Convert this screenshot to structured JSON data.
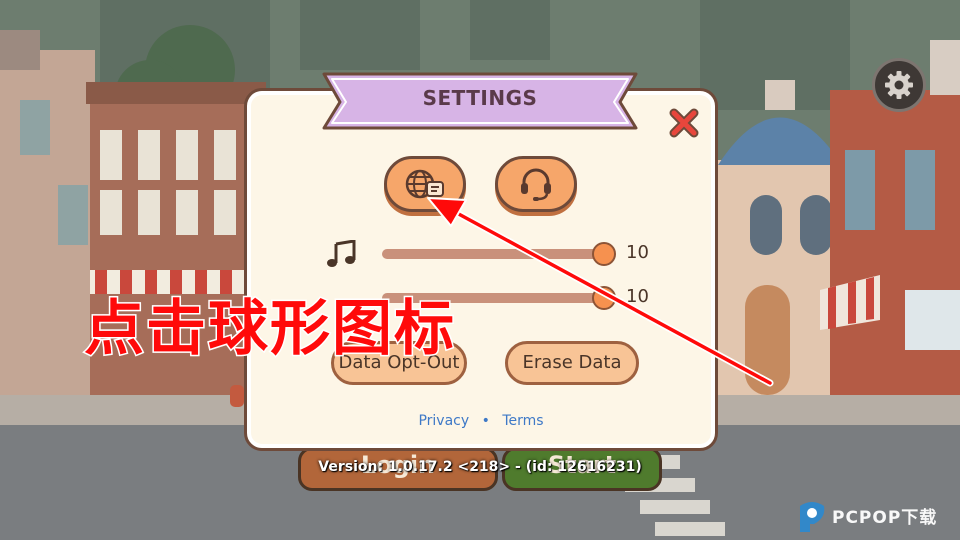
{
  "settings": {
    "title": "SETTINGS",
    "buttons": {
      "language": "globe-icon",
      "support": "headset-icon",
      "close": "close-icon"
    },
    "sliders": [
      {
        "name": "music",
        "icon": "music-note-icon",
        "value": "10",
        "level": 1.0
      },
      {
        "name": "sound",
        "icon": "sound-icon",
        "value": "10",
        "level": 1.0
      }
    ],
    "data_opt_out_label": "Data Opt-Out",
    "erase_data_label": "Erase Data",
    "links": {
      "privacy": "Privacy",
      "separator": "•",
      "terms": "Terms"
    }
  },
  "background": {
    "login_label": "Login",
    "start_label": "Start",
    "version": "Version: 1.0.17.2 <218> - (id: 12616231)"
  },
  "overlay": {
    "instruction": "点击球形图标",
    "arrow_color": "#ff0a0a"
  },
  "watermark": {
    "text": "PCPOP下载"
  },
  "colors": {
    "panel_bg": "#fdf6e7",
    "banner": "#d7b4e6",
    "button_orange": "#f6a66a",
    "close_red": "#e8463c",
    "link_blue": "#3e79c7"
  }
}
